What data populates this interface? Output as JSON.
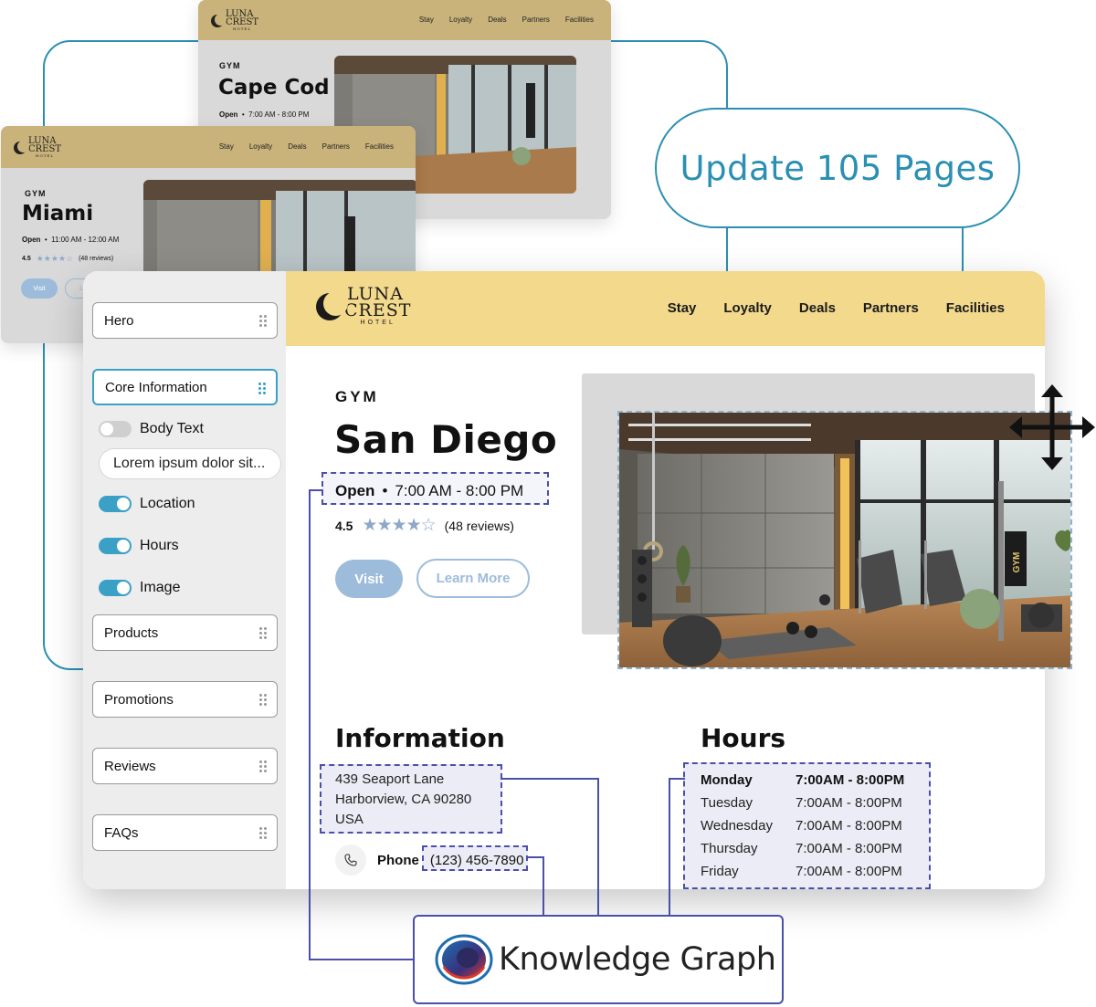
{
  "update_pill": {
    "label": "Update 105 Pages"
  },
  "brand": {
    "line1": "LUNA",
    "line2": "CREST",
    "line3": "HOTEL"
  },
  "nav": {
    "items": [
      "Stay",
      "Loyalty",
      "Deals",
      "Partners",
      "Facilities"
    ]
  },
  "cape_cod_page": {
    "kicker": "GYM",
    "title": "Cape Cod",
    "status": "Open",
    "hours": "7:00 AM - 8:00 PM"
  },
  "miami_page": {
    "kicker": "GYM",
    "title": "Miami",
    "status": "Open",
    "hours": "11:00 AM - 12:00 AM",
    "rating": "4.5",
    "reviews": "(48 reviews)",
    "visit_label": "Visit",
    "learn_label": "Le"
  },
  "editor": {
    "blocks": {
      "hero": "Hero",
      "core_information": "Core Information",
      "products": "Products",
      "promotions": "Promotions",
      "reviews": "Reviews",
      "faqs": "FAQs"
    },
    "toggles": {
      "body_text": {
        "label": "Body Text",
        "on": false
      },
      "location": {
        "label": "Location",
        "on": true
      },
      "hours": {
        "label": "Hours",
        "on": true
      },
      "image": {
        "label": "Image",
        "on": true
      }
    },
    "body_text_value": "Lorem ipsum dolor sit..."
  },
  "san_diego_page": {
    "kicker": "GYM",
    "title": "San Diego",
    "status": "Open",
    "separator": "•",
    "hours": "7:00 AM - 8:00 PM",
    "rating": "4.5",
    "stars": "★★★★☆",
    "reviews": "(48 reviews)",
    "visit_label": "Visit",
    "learn_label": "Learn More",
    "info_heading": "Information",
    "address": [
      "439 Seaport Lane",
      "Harborview, CA 90280",
      "USA"
    ],
    "phone_label": "Phone",
    "phone_value": "(123) 456-7890",
    "hours_heading": "Hours",
    "hours_table": [
      {
        "day": "Monday",
        "time": "7:00AM - 8:00PM"
      },
      {
        "day": "Tuesday",
        "time": "7:00AM - 8:00PM"
      },
      {
        "day": "Wednesday",
        "time": "7:00AM - 8:00PM"
      },
      {
        "day": "Thursday",
        "time": "7:00AM - 8:00PM"
      },
      {
        "day": "Friday",
        "time": "7:00AM - 8:00PM"
      }
    ]
  },
  "knowledge_graph": {
    "label": "Knowledge Graph"
  },
  "colors": {
    "teal": "#2b8fb3",
    "purple": "#4a4fa8",
    "nav_gold": "#f2d98c",
    "accent_blue": "#3aa0c6",
    "button_blue": "#9dbcdb"
  },
  "icons": [
    "drag-handle-icon",
    "phone-icon",
    "move-arrows-icon",
    "knowledge-graph-logo-icon",
    "star-icon",
    "moon-logo-icon"
  ]
}
